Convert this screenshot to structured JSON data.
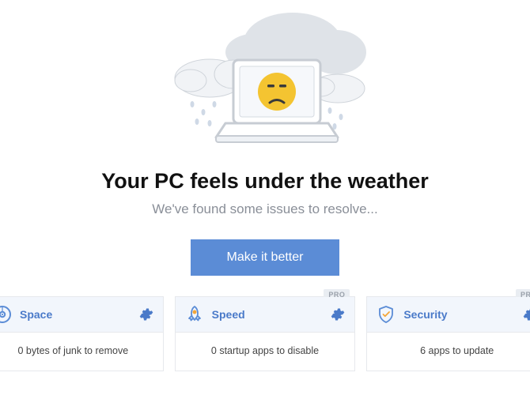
{
  "hero": {
    "headline": "Your PC feels under the weather",
    "subhead": "We've found some issues to resolve...",
    "cta_label": "Make it better"
  },
  "cards": [
    {
      "title": "Space",
      "status": "0 bytes of junk to remove",
      "pro": false,
      "icon": "disk-icon"
    },
    {
      "title": "Speed",
      "status": "0 startup apps to disable",
      "pro": true,
      "icon": "rocket-icon"
    },
    {
      "title": "Security",
      "status": "6 apps to update",
      "pro": true,
      "icon": "shield-icon"
    }
  ],
  "badges": {
    "pro_label": "PRO"
  },
  "colors": {
    "accent": "#5b8cd6",
    "link": "#4a7ac9",
    "muted": "#8a8f98",
    "panel": "#f2f6fc"
  }
}
